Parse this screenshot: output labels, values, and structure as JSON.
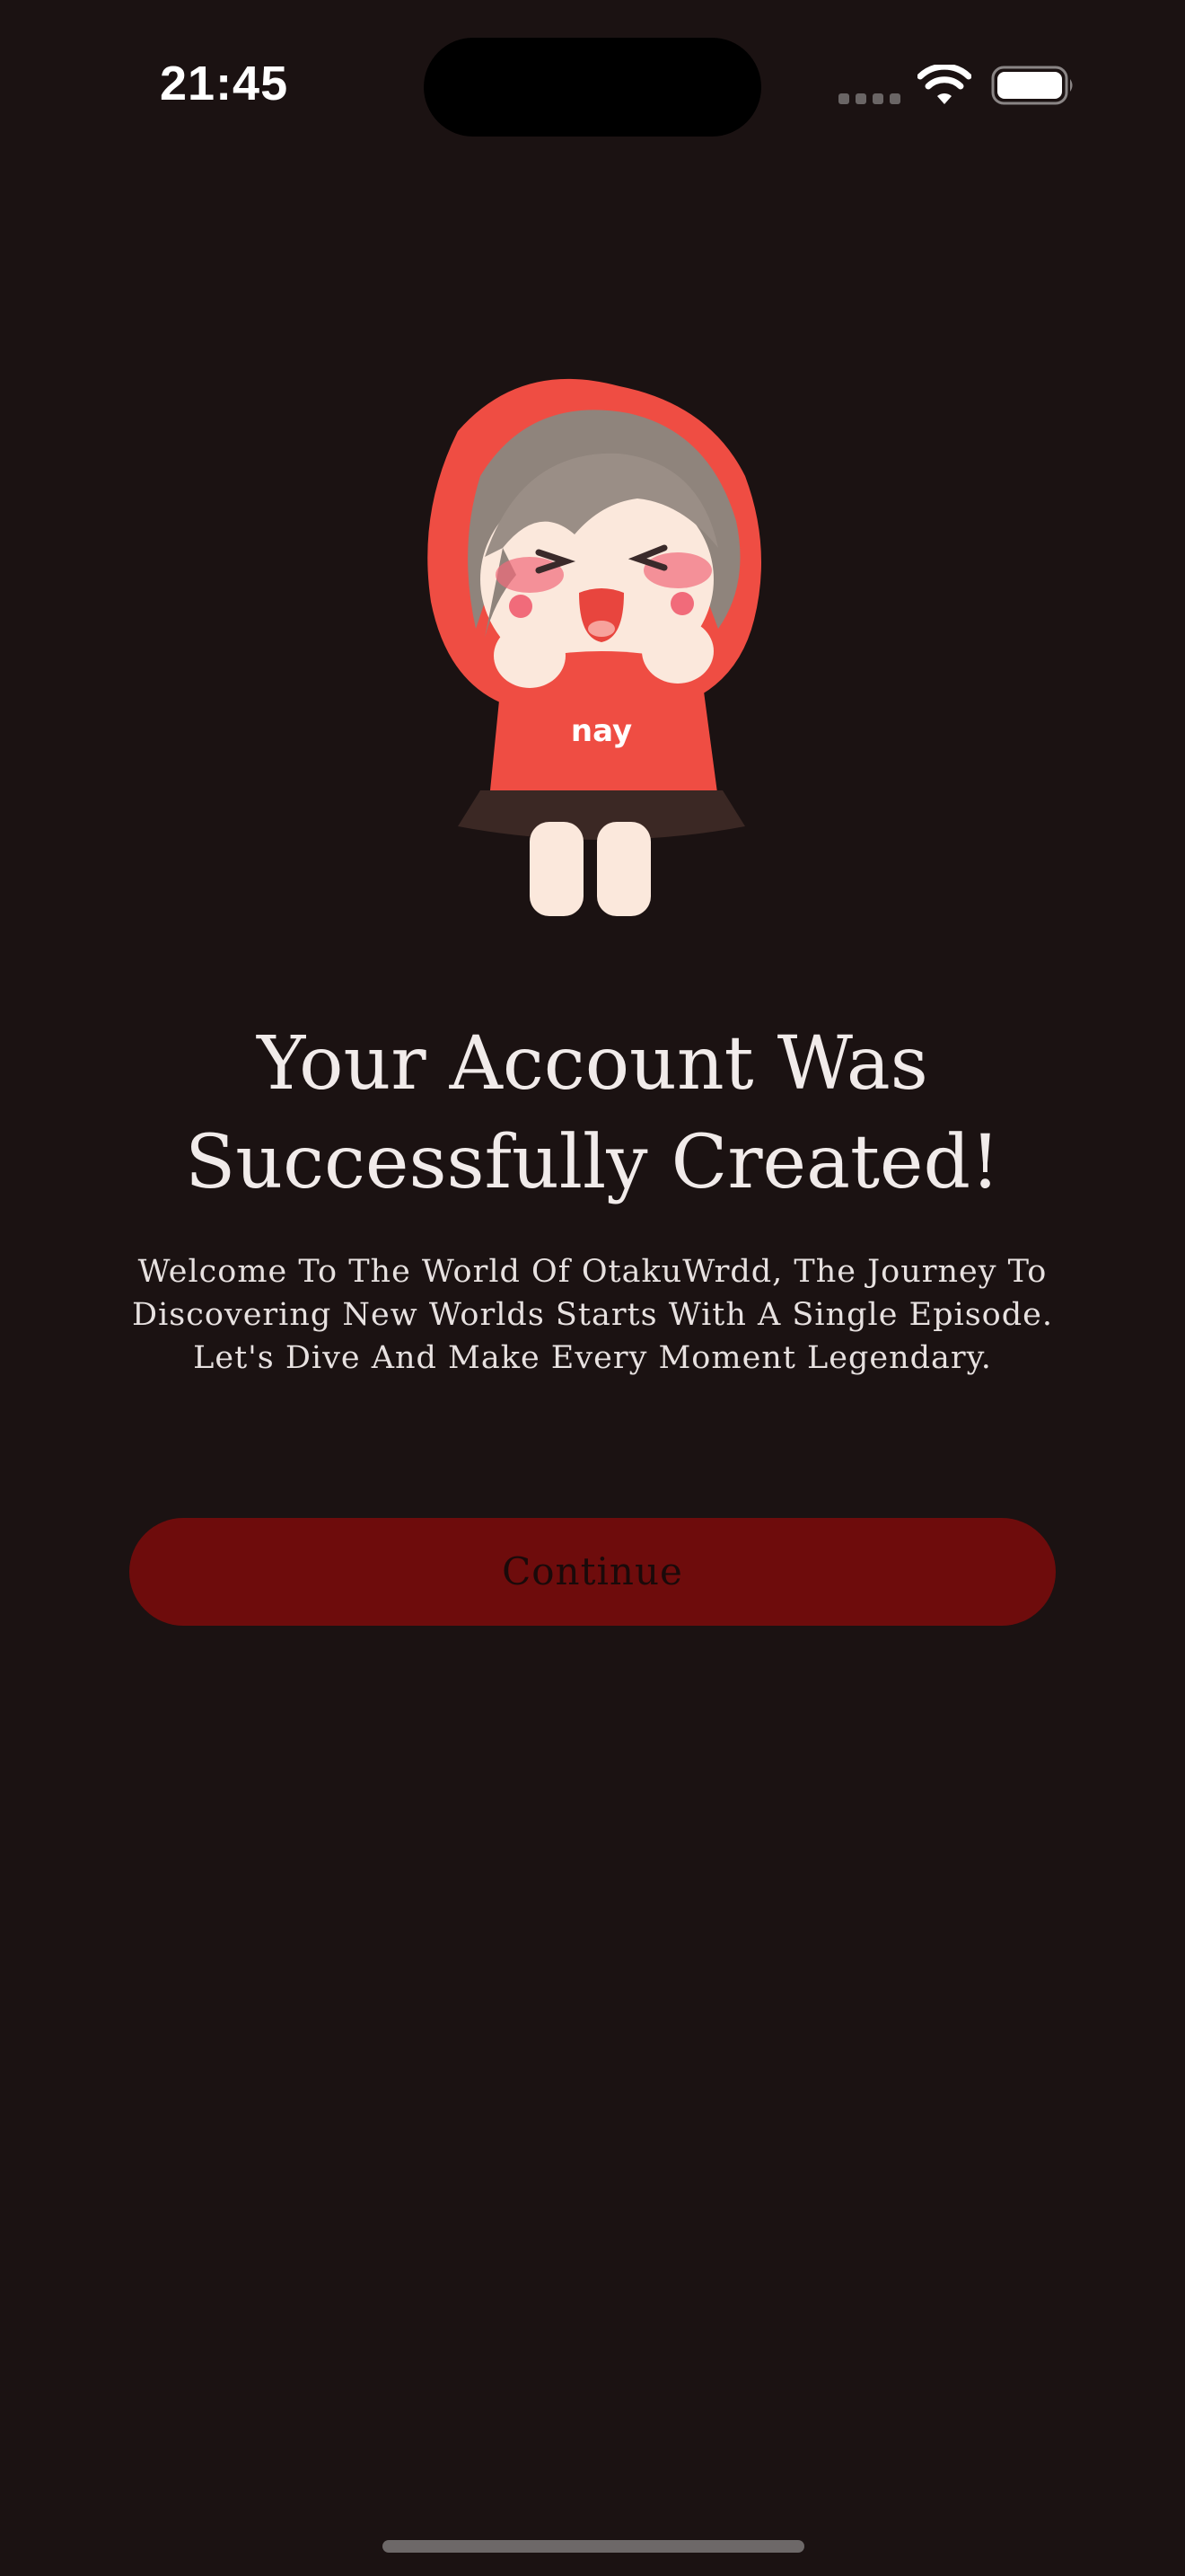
{
  "status_bar": {
    "time": "21:45",
    "icons": [
      "cellular-signal-icon",
      "wifi-icon",
      "battery-icon"
    ]
  },
  "illustration": {
    "name": "chibi-mascot-illustration",
    "shirt_text": "nay"
  },
  "main": {
    "title": "Your Account Was Successfully Created!",
    "description": "Welcome To The World Of OtakuWrdd, The Journey To Discovering New Worlds Starts With A Single Episode. Let's Dive And Make Every Moment Legendary.",
    "continue_label": "Continue"
  },
  "colors": {
    "background": "#1b1212",
    "button": "#6e0c0c",
    "button_text": "#1a0a0a",
    "text": "#f1ebea",
    "mascot_hood": "#ef4d43"
  }
}
